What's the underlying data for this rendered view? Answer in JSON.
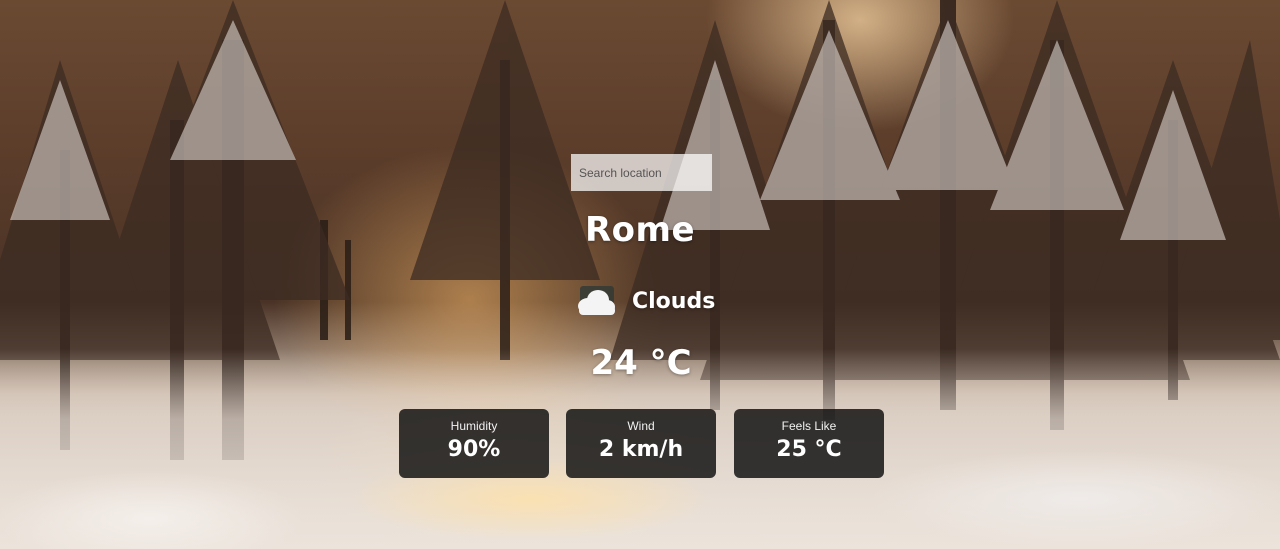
{
  "search": {
    "placeholder": "Search location",
    "value": ""
  },
  "weather": {
    "city": "Rome",
    "condition": "Clouds",
    "condition_icon": "cloud-icon",
    "temperature": "24 °C"
  },
  "stats": {
    "humidity": {
      "label": "Humidity",
      "value": "90%"
    },
    "wind": {
      "label": "Wind",
      "value": "2 km/h"
    },
    "feels_like": {
      "label": "Feels Like",
      "value": "25 °C"
    }
  },
  "background": {
    "icon": "snowy-forest-photo"
  },
  "colors": {
    "text": "#ffffff",
    "card_bg": "#0c0c0c"
  }
}
